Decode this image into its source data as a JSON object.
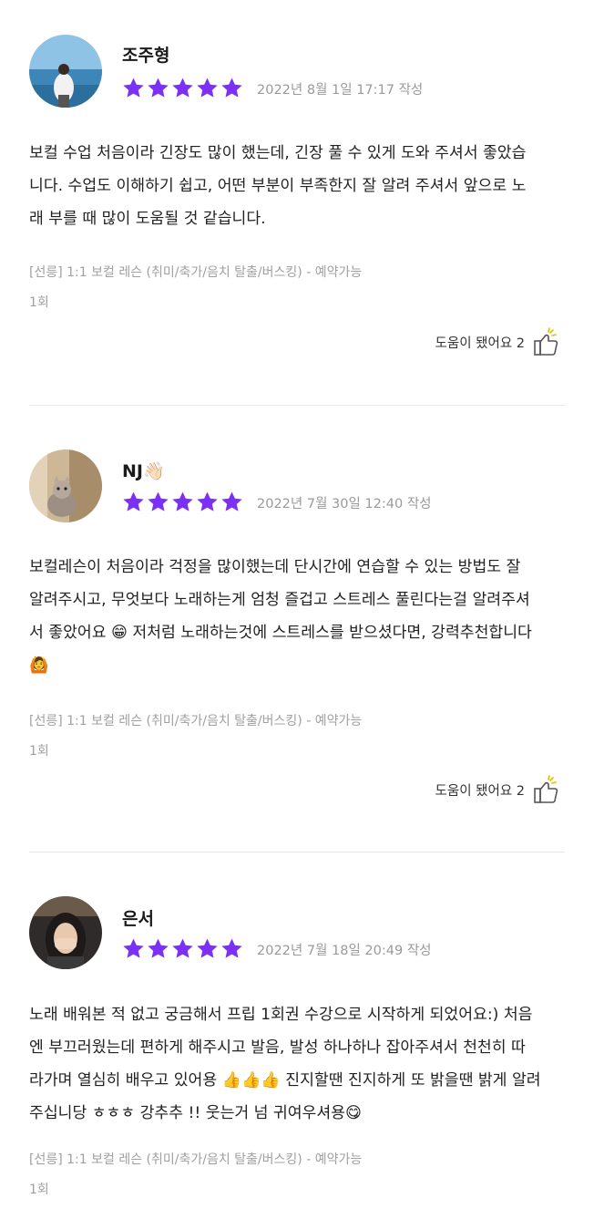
{
  "colors": {
    "star": "#7B2FF7",
    "divider": "#e8e8e8",
    "muted": "#9a9a9a"
  },
  "reviews": [
    {
      "name": "조주형",
      "rating": 5,
      "date": "2022년 8월 1일 17:17 작성",
      "lines": [
        "보컬 수업 처음이라 긴장도 많이 했는데, 긴장 풀 수 있게 도와 주셔서 좋았습",
        "니다. 수업도 이해하기 쉽고, 어떤 부분이 부족한지 잘 알려 주셔서 앞으로 노",
        "래 부를 때 많이 도움될 것 같습니다."
      ],
      "product": "[선릉] 1:1 보컬 레슨 (취미/축가/음치 탈출/버스킹) - 예약가능",
      "sessions": "1회",
      "helpful": "도움이 됐어요 2"
    },
    {
      "name": "NJ👋🏻",
      "rating": 5,
      "date": "2022년 7월 30일 12:40 작성",
      "lines": [
        "보컬레슨이 처음이라 걱정을 많이했는데 단시간에 연습할 수 있는 방법도 잘",
        "알려주시고, 무엇보다 노래하는게 엄청 즐겁고 스트레스 풀린다는걸 알려주셔",
        "서 좋았어요 😁 저처럼 노래하는것에 스트레스를 받으셨다면, 강력추천합니다",
        "🙆"
      ],
      "product": "[선릉] 1:1 보컬 레슨 (취미/축가/음치 탈출/버스킹) - 예약가능",
      "sessions": "1회",
      "helpful": "도움이 됐어요 2"
    },
    {
      "name": "은서",
      "rating": 5,
      "date": "2022년 7월 18일 20:49 작성",
      "lines": [
        "노래 배워본 적 없고 궁금해서 프립 1회권 수강으로 시작하게 되었어요:) 처음",
        "엔 부끄러웠는데 편하게 해주시고 발음, 발성 하나하나 잡아주셔서 천천히 따",
        "라가며 열심히 배우고 있어용 👍👍👍 진지할땐 진지하게 또 밝을땐 밝게 알려",
        "주십니당 ㅎㅎㅎ 강추추 !! 웃는거 넘 귀여우셔용😋"
      ],
      "product": "[선릉] 1:1 보컬 레슨 (취미/축가/음치 탈출/버스킹) - 예약가능",
      "sessions": "1회"
    }
  ]
}
